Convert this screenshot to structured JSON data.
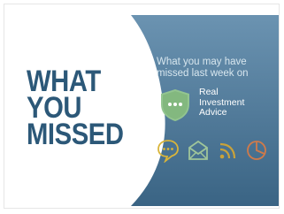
{
  "headline": {
    "line1": "WHAT",
    "line2": "YOU",
    "line3": "MISSED"
  },
  "intro": {
    "line1": "What you may have",
    "line2": "missed last week on"
  },
  "brand": {
    "line1": "Real",
    "line2": "Investment",
    "line3": "Advice"
  },
  "icons": [
    "chat-bubble-icon",
    "envelope-icon",
    "rss-feed-icon",
    "pie-chart-icon"
  ],
  "colors": {
    "headline": "#2c5878",
    "panel_top": "#5f8aaa",
    "panel_bottom": "#3b6585",
    "shield": "#8fc28c",
    "icon_stroke": "#d9b53a",
    "icon_stroke_alt": "#d07a4a"
  }
}
